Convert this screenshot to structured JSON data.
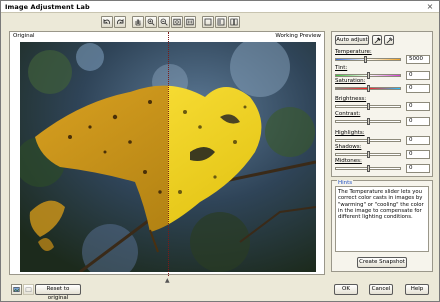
{
  "window": {
    "title": "Image Adjustment Lab",
    "close_glyph": "×"
  },
  "toolbar": {
    "buttons": [
      "undo-icon",
      "redo-icon",
      "hand-icon",
      "zoom-in-icon",
      "zoom-out-icon",
      "fit-window-icon",
      "actual-size-icon",
      "single-view-icon",
      "split-view-icon",
      "side-by-side-icon"
    ]
  },
  "preview": {
    "original_label": "Original",
    "working_label": "Working Preview"
  },
  "adjust": {
    "auto_adjust_label": "Auto adjust",
    "temperature": {
      "label": "Temperature:",
      "value": "5000"
    },
    "tint": {
      "label": "Tint:",
      "value": "0"
    },
    "saturation": {
      "label": "Saturation:",
      "value": "0"
    },
    "brightness": {
      "label": "Brightness:",
      "value": "0"
    },
    "contrast": {
      "label": "Contrast:",
      "value": "0"
    },
    "highlights": {
      "label": "Highlights:",
      "value": "0"
    },
    "shadows": {
      "label": "Shadows:",
      "value": "0"
    },
    "midtones": {
      "label": "Midtones:",
      "value": "0"
    }
  },
  "hints": {
    "title": "Hints",
    "text": "The Temperature slider lets you correct color casts in images by \"warming\" or \"cooling\" the color in the image to compensate for different lighting conditions.",
    "snapshot_label": "Create Snapshot"
  },
  "footer": {
    "reset_label": "Reset to original",
    "ok_label": "OK",
    "cancel_label": "Cancel",
    "help_label": "Help"
  }
}
